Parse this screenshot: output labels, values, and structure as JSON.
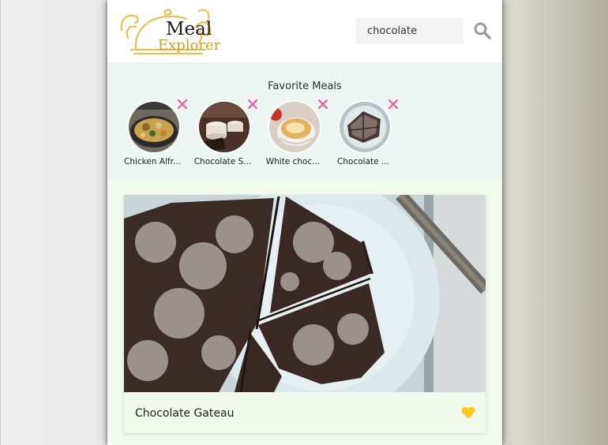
{
  "app": {
    "logo": {
      "line1": "Meal",
      "line2": "Explorer"
    },
    "colors": {
      "brand_gold": "#e6c24a",
      "accent_pink": "#ee5aa0",
      "heart": "#ffc61a",
      "panel": "#ecf5f2",
      "card": "#f1f8ec"
    }
  },
  "header": {
    "search": {
      "value": "chocolate",
      "placeholder": ""
    },
    "search_icon": "magnifier-icon"
  },
  "favorites": {
    "title": "Favorite Meals",
    "items": [
      {
        "label": "Chicken Alfr...",
        "remove_icon": "close-icon"
      },
      {
        "label": "Chocolate S...",
        "remove_icon": "close-icon"
      },
      {
        "label": "White choc...",
        "remove_icon": "close-icon"
      },
      {
        "label": "Chocolate ...",
        "remove_icon": "close-icon"
      }
    ]
  },
  "meals": [
    {
      "name": "Chocolate Gateau",
      "favorite": true,
      "favorite_icon": "heart-icon"
    }
  ]
}
